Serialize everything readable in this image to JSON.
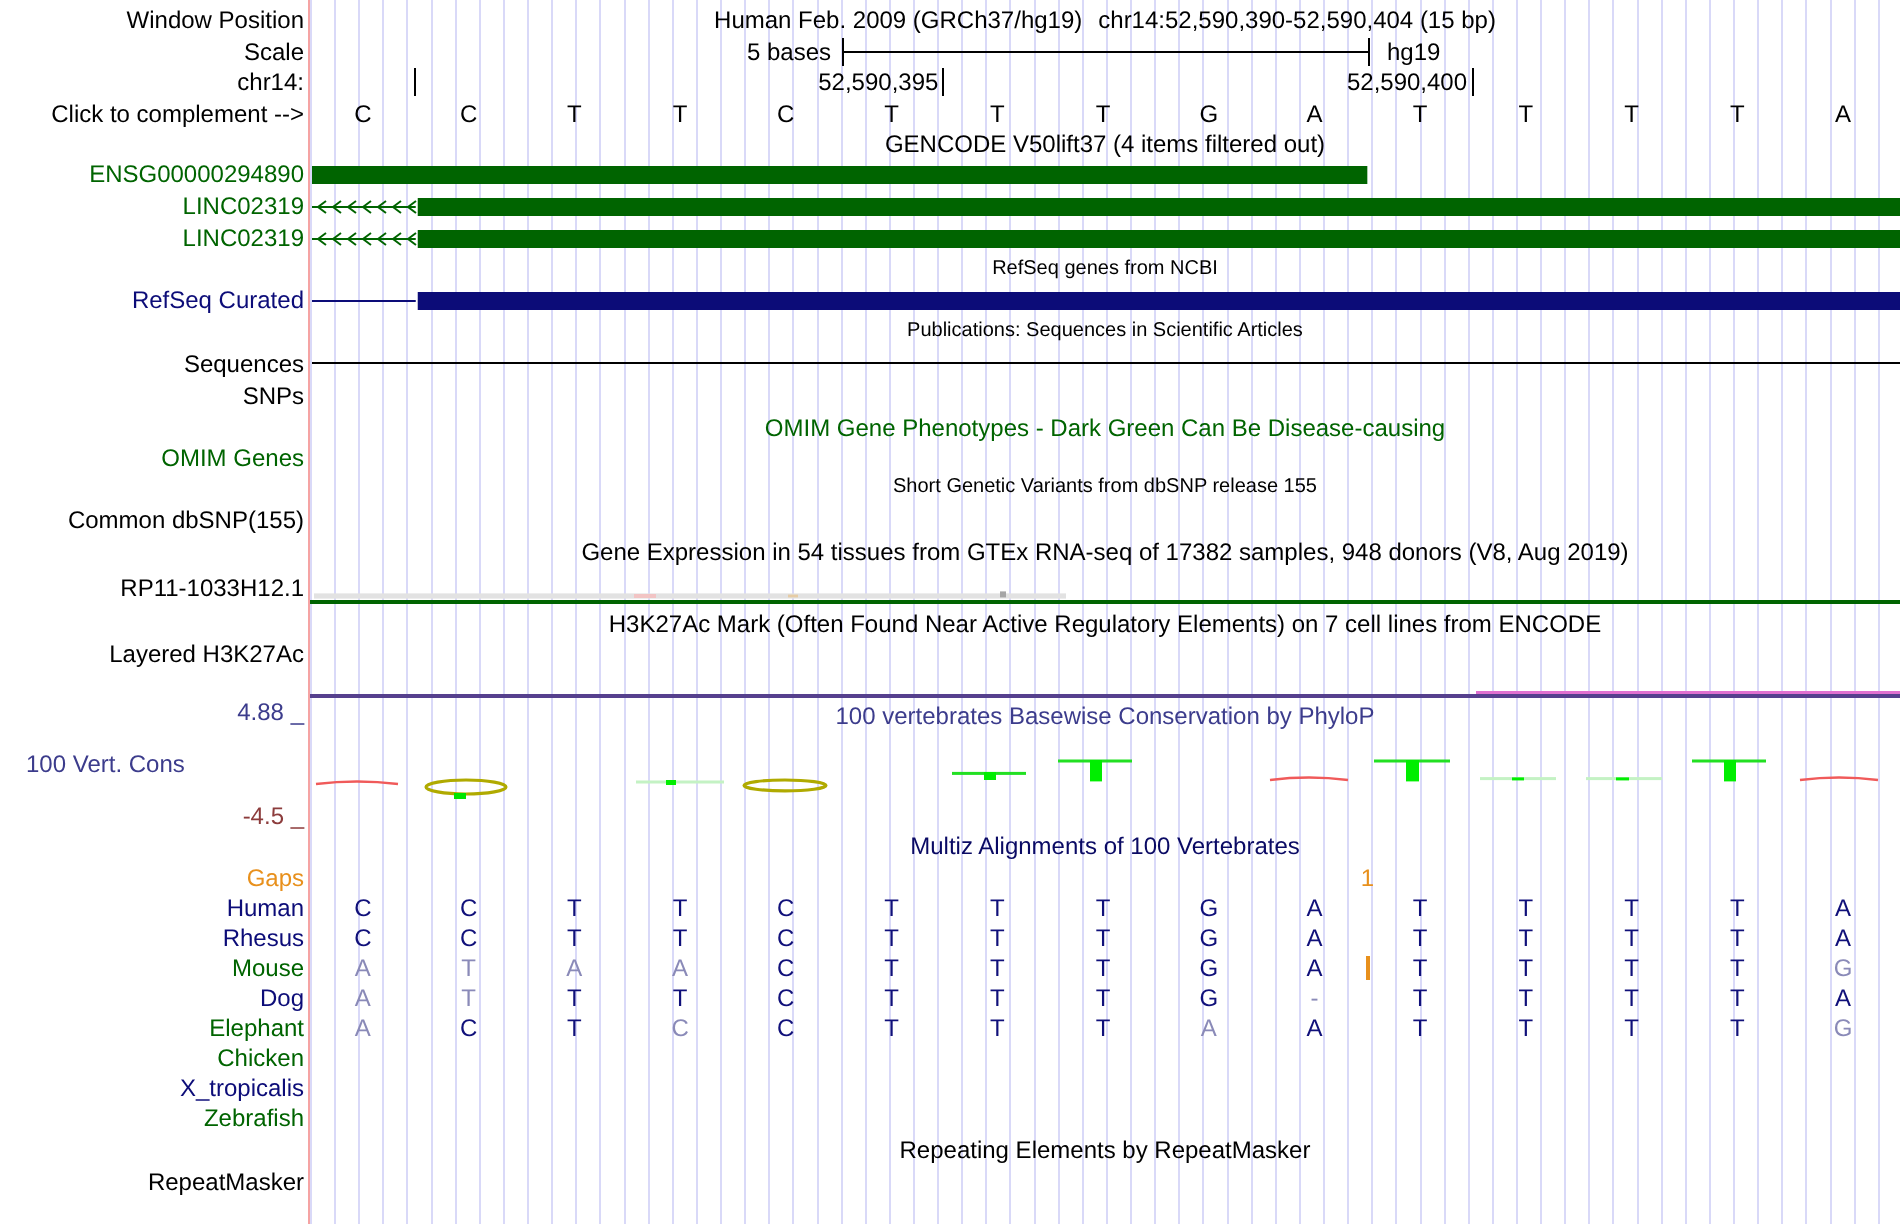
{
  "position": {
    "label": "Window Position",
    "assembly": "Human Feb. 2009 (GRCh37/hg19)",
    "range": "chr14:52,590,390-52,590,404 (15 bp)"
  },
  "scale": {
    "label": "Scale",
    "length": "5 bases",
    "assembly": "hg19"
  },
  "ruler": {
    "label": "chr14:",
    "ticks": [
      "52,590,395",
      "52,590,400"
    ]
  },
  "sequence": {
    "label": "Click to complement -->",
    "bases": [
      "C",
      "C",
      "T",
      "T",
      "C",
      "T",
      "T",
      "T",
      "G",
      "A",
      "T",
      "T",
      "T",
      "T",
      "A"
    ]
  },
  "tracks": [
    {
      "kind": "genes",
      "title": "GENCODE V50lift37 (4 items filtered out)",
      "color": "#006400",
      "items": [
        {
          "label": "ENSG00000294890",
          "kind": "block"
        },
        {
          "label": "LINC02319",
          "kind": "spliced"
        },
        {
          "label": "LINC02319",
          "kind": "spliced"
        }
      ]
    },
    {
      "kind": "refseq",
      "title": "RefSeq genes from NCBI",
      "color": "#0c0c78",
      "items": [
        {
          "label": "RefSeq Curated",
          "kind": "spliced"
        }
      ]
    },
    {
      "kind": "pubs",
      "title": "Publications: Sequences in Scientific Articles",
      "items": [
        {
          "label": "Sequences",
          "kind": "line"
        },
        {
          "label": "SNPs",
          "kind": "empty"
        }
      ]
    },
    {
      "kind": "omim",
      "title": "OMIM Gene Phenotypes - Dark Green Can Be Disease-causing",
      "color": "#006400",
      "items": [
        {
          "label": "OMIM Genes"
        }
      ]
    },
    {
      "kind": "variants",
      "title": "Short Genetic Variants from dbSNP release 155",
      "items": [
        {
          "label": "Common dbSNP(155)"
        }
      ]
    },
    {
      "kind": "expression",
      "title": "Gene Expression in 54 tissues from GTEx RNA-seq of 17382 samples, 948 donors (V8, Aug 2019)",
      "items": [
        {
          "label": "RP11-1033H12.1"
        }
      ]
    },
    {
      "kind": "chromatin",
      "title": "H3K27Ac Mark (Often Found Near Active Regulatory Elements) on 7 cell lines from ENCODE",
      "items": [
        {
          "label": "Layered H3K27Ac"
        }
      ]
    },
    {
      "kind": "conservation",
      "title": "100 vertebrates Basewise Conservation by PhyloP",
      "color": "#3c3c8c",
      "label": "100 Vert. Cons",
      "max": "4.88 _",
      "min": "-4.5 _"
    },
    {
      "kind": "alignment",
      "title": "Multiz Alignments of 100 Vertebrates",
      "color": "#0a0a64",
      "gaps": {
        "label": "Gaps",
        "count": "1",
        "color": "#e8901c"
      },
      "species": [
        {
          "name": "Human",
          "color": "#0c0c78",
          "bases": [
            {
              "base": "C",
              "match": true,
              "insertion": false
            },
            {
              "base": "C",
              "match": true,
              "insertion": false
            },
            {
              "base": "T",
              "match": true,
              "insertion": false
            },
            {
              "base": "T",
              "match": true,
              "insertion": false
            },
            {
              "base": "C",
              "match": true,
              "insertion": false
            },
            {
              "base": "T",
              "match": true,
              "insertion": false
            },
            {
              "base": "T",
              "match": true,
              "insertion": false
            },
            {
              "base": "T",
              "match": true,
              "insertion": false
            },
            {
              "base": "G",
              "match": true,
              "insertion": false
            },
            {
              "base": "A",
              "match": true,
              "insertion": false
            },
            {
              "base": "T",
              "match": true,
              "insertion": false
            },
            {
              "base": "T",
              "match": true,
              "insertion": false
            },
            {
              "base": "T",
              "match": true,
              "insertion": false
            },
            {
              "base": "T",
              "match": true,
              "insertion": false
            },
            {
              "base": "A",
              "match": true,
              "insertion": false
            }
          ]
        },
        {
          "name": "Rhesus",
          "color": "#0c0c78",
          "bases": [
            {
              "base": "C",
              "match": true,
              "insertion": false
            },
            {
              "base": "C",
              "match": true,
              "insertion": false
            },
            {
              "base": "T",
              "match": true,
              "insertion": false
            },
            {
              "base": "T",
              "match": true,
              "insertion": false
            },
            {
              "base": "C",
              "match": true,
              "insertion": false
            },
            {
              "base": "T",
              "match": true,
              "insertion": false
            },
            {
              "base": "T",
              "match": true,
              "insertion": false
            },
            {
              "base": "T",
              "match": true,
              "insertion": false
            },
            {
              "base": "G",
              "match": true,
              "insertion": false
            },
            {
              "base": "A",
              "match": true,
              "insertion": false
            },
            {
              "base": "T",
              "match": true,
              "insertion": false
            },
            {
              "base": "T",
              "match": true,
              "insertion": false
            },
            {
              "base": "T",
              "match": true,
              "insertion": false
            },
            {
              "base": "T",
              "match": true,
              "insertion": false
            },
            {
              "base": "A",
              "match": true,
              "insertion": false
            }
          ]
        },
        {
          "name": "Mouse",
          "color": "#006400",
          "bases": [
            {
              "base": "A",
              "match": false,
              "insertion": false
            },
            {
              "base": "T",
              "match": false,
              "insertion": false
            },
            {
              "base": "A",
              "match": false,
              "insertion": false
            },
            {
              "base": "A",
              "match": false,
              "insertion": false
            },
            {
              "base": "C",
              "match": true,
              "insertion": false
            },
            {
              "base": "T",
              "match": true,
              "insertion": false
            },
            {
              "base": "T",
              "match": true,
              "insertion": false
            },
            {
              "base": "T",
              "match": true,
              "insertion": false
            },
            {
              "base": "G",
              "match": true,
              "insertion": false
            },
            {
              "base": "A",
              "match": true,
              "insertion": true
            },
            {
              "base": "T",
              "match": true,
              "insertion": false
            },
            {
              "base": "T",
              "match": true,
              "insertion": false
            },
            {
              "base": "T",
              "match": true,
              "insertion": false
            },
            {
              "base": "T",
              "match": true,
              "insertion": false
            },
            {
              "base": "G",
              "match": false,
              "insertion": false
            }
          ]
        },
        {
          "name": "Dog",
          "color": "#0c0c78",
          "bases": [
            {
              "base": "A",
              "match": false,
              "insertion": false
            },
            {
              "base": "T",
              "match": false,
              "insertion": false
            },
            {
              "base": "T",
              "match": true,
              "insertion": false
            },
            {
              "base": "T",
              "match": true,
              "insertion": false
            },
            {
              "base": "C",
              "match": true,
              "insertion": false
            },
            {
              "base": "T",
              "match": true,
              "insertion": false
            },
            {
              "base": "T",
              "match": true,
              "insertion": false
            },
            {
              "base": "T",
              "match": true,
              "insertion": false
            },
            {
              "base": "G",
              "match": true,
              "insertion": false
            },
            {
              "base": "-",
              "match": false,
              "insertion": false
            },
            {
              "base": "T",
              "match": true,
              "insertion": false
            },
            {
              "base": "T",
              "match": true,
              "insertion": false
            },
            {
              "base": "T",
              "match": true,
              "insertion": false
            },
            {
              "base": "T",
              "match": true,
              "insertion": false
            },
            {
              "base": "A",
              "match": true,
              "insertion": false
            }
          ]
        },
        {
          "name": "Elephant",
          "color": "#006400",
          "bases": [
            {
              "base": "A",
              "match": false,
              "insertion": false
            },
            {
              "base": "C",
              "match": true,
              "insertion": false
            },
            {
              "base": "T",
              "match": true,
              "insertion": false
            },
            {
              "base": "C",
              "match": false,
              "insertion": false
            },
            {
              "base": "C",
              "match": true,
              "insertion": false
            },
            {
              "base": "T",
              "match": true,
              "insertion": false
            },
            {
              "base": "T",
              "match": true,
              "insertion": false
            },
            {
              "base": "T",
              "match": true,
              "insertion": false
            },
            {
              "base": "A",
              "match": false,
              "insertion": false
            },
            {
              "base": "A",
              "match": true,
              "insertion": false
            },
            {
              "base": "T",
              "match": true,
              "insertion": false
            },
            {
              "base": "T",
              "match": true,
              "insertion": false
            },
            {
              "base": "T",
              "match": true,
              "insertion": false
            },
            {
              "base": "T",
              "match": true,
              "insertion": false
            },
            {
              "base": "G",
              "match": false,
              "insertion": false
            }
          ]
        },
        {
          "name": "Chicken",
          "color": "#006400"
        },
        {
          "name": "X_tropicalis",
          "color": "#0c0c78"
        },
        {
          "name": "Zebrafish",
          "color": "#006400"
        }
      ]
    },
    {
      "kind": "repeats",
      "title": "Repeating Elements by RepeatMasker",
      "items": [
        {
          "label": "RepeatMasker"
        }
      ]
    }
  ]
}
